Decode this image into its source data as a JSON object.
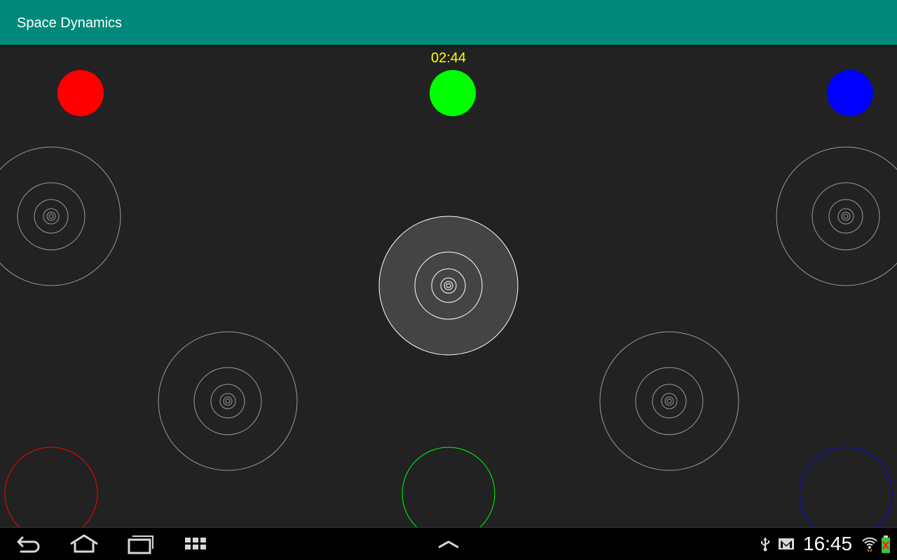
{
  "app_bar": {
    "title": "Space Dynamics",
    "color": "#00897b"
  },
  "game": {
    "timer": "02:44",
    "timer_color": "#ffff00",
    "players": [
      {
        "id": "red",
        "color": "#ff0000"
      },
      {
        "id": "green",
        "color": "#00ff00"
      },
      {
        "id": "blue",
        "color": "#0000ff"
      }
    ],
    "active_planet": "center"
  },
  "navigation": {
    "back_icon": "back-arrow-icon",
    "home_icon": "home-icon",
    "recents_icon": "recent-apps-icon",
    "apps_icon": "app-grid-icon",
    "menu_icon": "chevron-up-icon"
  },
  "status_bar": {
    "time": "16:45",
    "icons": [
      "usb-icon",
      "gmail-icon",
      "wifi-icon",
      "battery-icon"
    ]
  }
}
